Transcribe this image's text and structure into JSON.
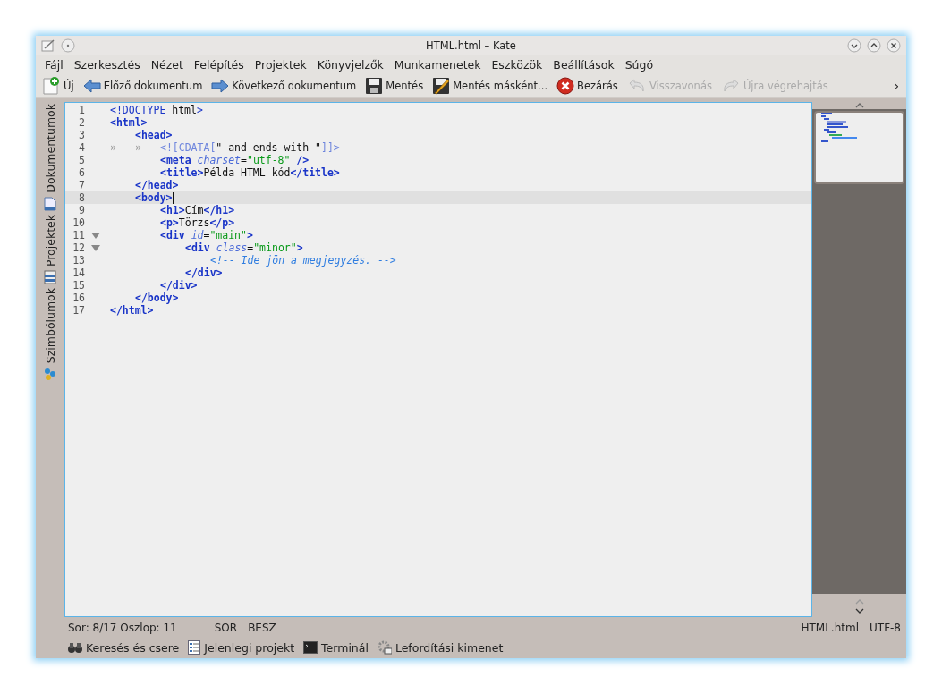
{
  "window": {
    "title": "HTML.html – Kate"
  },
  "menu": [
    "Fájl",
    "Szerkesztés",
    "Nézet",
    "Felépítés",
    "Projektek",
    "Könyvjelzők",
    "Munkamenetek",
    "Eszközök",
    "Beállítások",
    "Súgó"
  ],
  "toolbar": [
    {
      "kind": "new",
      "label": "Új",
      "disabled": false
    },
    {
      "kind": "prev",
      "label": "Előző dokumentum",
      "disabled": false
    },
    {
      "kind": "next",
      "label": "Következő dokumentum",
      "disabled": false
    },
    {
      "kind": "save",
      "label": "Mentés",
      "disabled": false
    },
    {
      "kind": "saveas",
      "label": "Mentés másként...",
      "disabled": false
    },
    {
      "kind": "close",
      "label": "Bezárás",
      "disabled": false
    },
    {
      "kind": "undo",
      "label": "Visszavonás",
      "disabled": true
    },
    {
      "kind": "redo",
      "label": "Újra végrehajtás",
      "disabled": true
    }
  ],
  "toolbar_more": "›",
  "side_tabs": [
    {
      "label": "Dokumentumok",
      "kind": "docs"
    },
    {
      "label": "Projektek",
      "kind": "project"
    },
    {
      "label": "Szimbólumok",
      "kind": "symbols"
    }
  ],
  "editor": {
    "lines": [
      {
        "number": "1",
        "tokens": [
          {
            "kind": "tag",
            "text": "<!DOCTYPE "
          },
          {
            "kind": "text",
            "text": "html"
          },
          {
            "kind": "tag",
            "text": ">"
          }
        ]
      },
      {
        "number": "2",
        "tokens": [
          {
            "kind": "tagb",
            "text": "<html>"
          }
        ],
        "children": [
          {
            "number": "3",
            "tokens": [
              {
                "kind": "tagb",
                "text": "<head>"
              }
            ],
            "children": [
              {
                "number": "4",
                "tab_marks": [
                  "»",
                  "»"
                ],
                "tokens": [
                  {
                    "kind": "cdata",
                    "text": "<![CDATA["
                  },
                  {
                    "kind": "text",
                    "text": "\" and ends with \""
                  },
                  {
                    "kind": "cdata",
                    "text": "]]>"
                  }
                ]
              },
              {
                "number": "5",
                "tokens": [
                  {
                    "kind": "tagb",
                    "text": "<meta "
                  },
                  {
                    "kind": "attr",
                    "text": "charset"
                  },
                  {
                    "kind": "text",
                    "text": "="
                  },
                  {
                    "kind": "value",
                    "text": "\"utf-8\""
                  },
                  {
                    "kind": "tagb",
                    "text": " />"
                  }
                ]
              },
              {
                "number": "6",
                "tokens": [
                  {
                    "kind": "tagb",
                    "text": "<title>"
                  },
                  {
                    "kind": "text",
                    "text": "Példa HTML kód"
                  },
                  {
                    "kind": "tagb",
                    "text": "</title>"
                  }
                ]
              }
            ]
          },
          {
            "number": "7",
            "tokens": [
              {
                "kind": "tagb",
                "text": "</head>"
              }
            ]
          },
          {
            "number": "8",
            "current": true,
            "tokens": [
              {
                "kind": "tagb",
                "text": "<body>"
              }
            ],
            "children": [
              {
                "number": "9",
                "tokens": [
                  {
                    "kind": "tagb",
                    "text": "<h1>"
                  },
                  {
                    "kind": "text",
                    "text": "Cím"
                  },
                  {
                    "kind": "tagb",
                    "text": "</h1>"
                  }
                ]
              },
              {
                "number": "10",
                "tokens": [
                  {
                    "kind": "tagb",
                    "text": "<p>"
                  },
                  {
                    "kind": "text",
                    "text": "Törzs"
                  },
                  {
                    "kind": "tagb",
                    "text": "</p>"
                  }
                ]
              },
              {
                "number": "11",
                "fold": true,
                "tokens": [
                  {
                    "kind": "tagb",
                    "text": "<div "
                  },
                  {
                    "kind": "attr",
                    "text": "id"
                  },
                  {
                    "kind": "text",
                    "text": "="
                  },
                  {
                    "kind": "value",
                    "text": "\"main\""
                  },
                  {
                    "kind": "tagb",
                    "text": ">"
                  }
                ],
                "children": [
                  {
                    "number": "12",
                    "fold": true,
                    "tokens": [
                      {
                        "kind": "tagb",
                        "text": "<div "
                      },
                      {
                        "kind": "attr",
                        "text": "class"
                      },
                      {
                        "kind": "text",
                        "text": "="
                      },
                      {
                        "kind": "value",
                        "text": "\"minor\""
                      },
                      {
                        "kind": "tagb",
                        "text": ">"
                      }
                    ],
                    "children": [
                      {
                        "number": "13",
                        "tokens": [
                          {
                            "kind": "comment",
                            "text": "<!-- Ide jön a megjegyzés. -->"
                          }
                        ]
                      }
                    ]
                  },
                  {
                    "number": "14",
                    "tokens": [
                      {
                        "kind": "tagb",
                        "text": "</div>"
                      }
                    ]
                  }
                ]
              },
              {
                "number": "15",
                "tokens": [
                  {
                    "kind": "tagb",
                    "text": "</div>"
                  }
                ]
              }
            ]
          },
          {
            "number": "16",
            "tokens": [
              {
                "kind": "tagb",
                "text": "</body>"
              }
            ]
          }
        ]
      },
      {
        "number": "17",
        "tokens": [
          {
            "kind": "tagb",
            "text": "</html>"
          }
        ]
      }
    ]
  },
  "status_bar": {
    "position": "Sor: 8/17 Oszlop: 11",
    "mode": "SOR",
    "input": "BESZ",
    "file": "HTML.html",
    "encoding": "UTF-8"
  },
  "tool_views": [
    {
      "kind": "binoculars",
      "label": "Keresés és csere"
    },
    {
      "kind": "list",
      "label": "Jelenlegi projekt"
    },
    {
      "kind": "terminal",
      "label": "Terminál"
    },
    {
      "kind": "gear",
      "label": "Lefordítási kimenet"
    }
  ]
}
